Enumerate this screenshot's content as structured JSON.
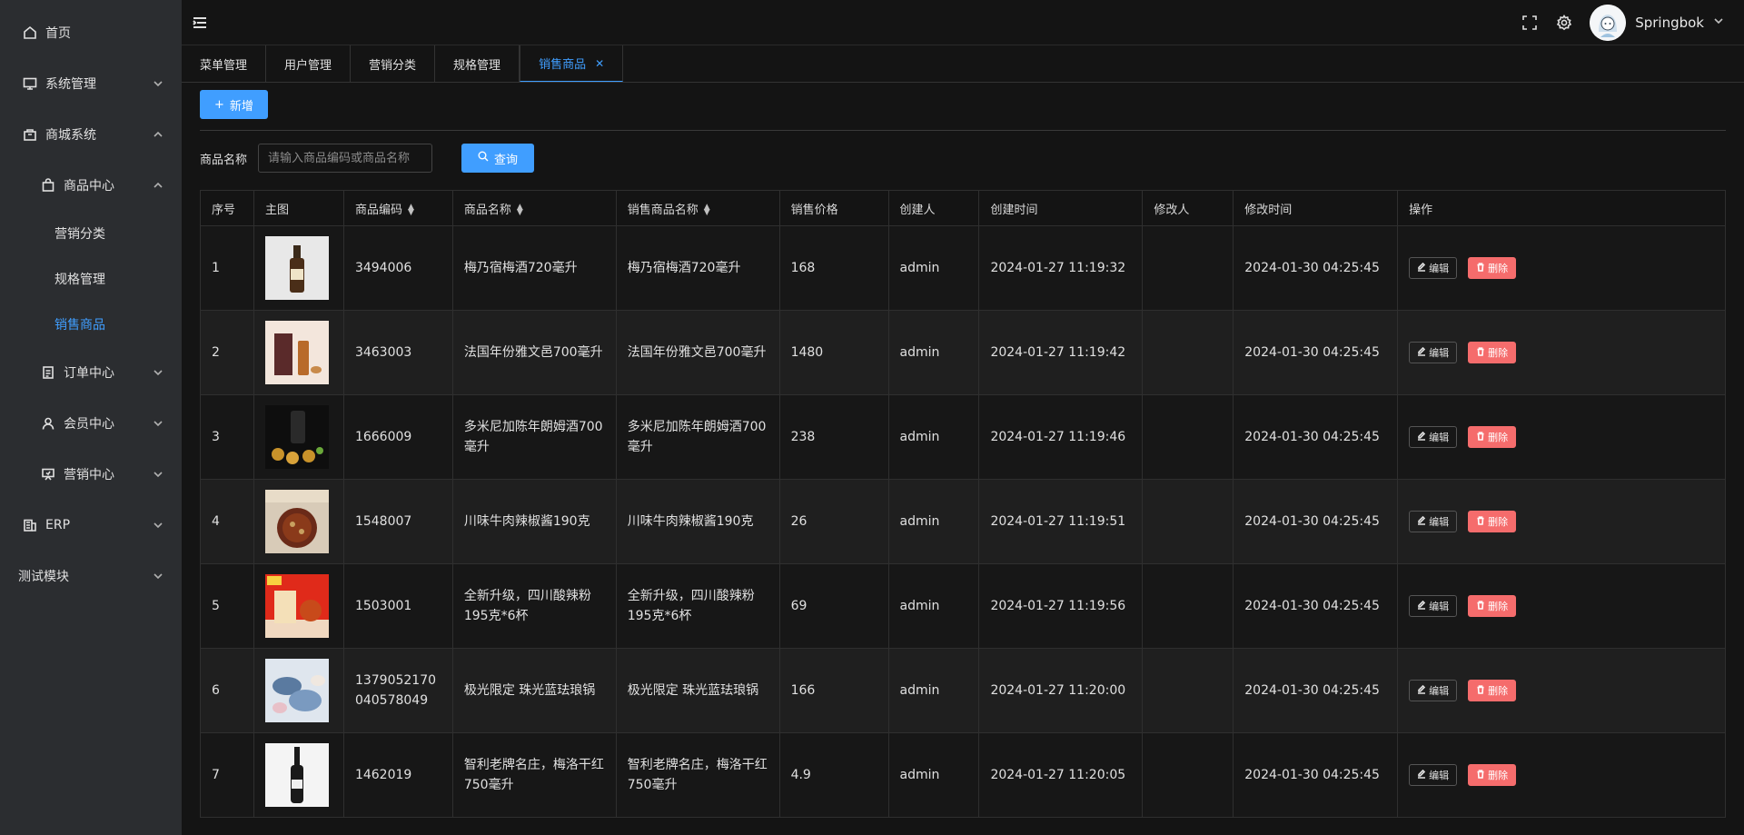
{
  "sidebar": {
    "home": "首页",
    "system": "系统管理",
    "mall": "商城系统",
    "goods_center": "商品中心",
    "marketing_category": "营销分类",
    "spec_manage": "规格管理",
    "sale_goods": "销售商品",
    "order_center": "订单中心",
    "member_center": "会员中心",
    "marketing_center": "营销中心",
    "erp": "ERP",
    "test_module": "测试模块"
  },
  "header": {
    "username": "Springbok"
  },
  "tabs": [
    "菜单管理",
    "用户管理",
    "营销分类",
    "规格管理",
    "销售商品"
  ],
  "toolbar": {
    "add_label": "新增"
  },
  "search": {
    "label": "商品名称",
    "placeholder": "请输入商品编码或商品名称",
    "query_label": "查询"
  },
  "table": {
    "headers": [
      "序号",
      "主图",
      "商品编码",
      "商品名称",
      "销售商品名称",
      "销售价格",
      "创建人",
      "创建时间",
      "修改人",
      "修改时间",
      "操作"
    ],
    "edit_label": "编辑",
    "delete_label": "删除",
    "rows": [
      {
        "no": "1",
        "code": "3494006",
        "name": "梅乃宿梅酒720毫升",
        "sale_name": "梅乃宿梅酒720毫升",
        "price": "168",
        "creator": "admin",
        "created": "2024-01-27 11:19:32",
        "modifier": "",
        "modified": "2024-01-30 04:25:45"
      },
      {
        "no": "2",
        "code": "3463003",
        "name": "法国年份雅文邑700毫升",
        "sale_name": "法国年份雅文邑700毫升",
        "price": "1480",
        "creator": "admin",
        "created": "2024-01-27 11:19:42",
        "modifier": "",
        "modified": "2024-01-30 04:25:45"
      },
      {
        "no": "3",
        "code": "1666009",
        "name": "多米尼加陈年朗姆酒700毫升",
        "sale_name": "多米尼加陈年朗姆酒700毫升",
        "price": "238",
        "creator": "admin",
        "created": "2024-01-27 11:19:46",
        "modifier": "",
        "modified": "2024-01-30 04:25:45"
      },
      {
        "no": "4",
        "code": "1548007",
        "name": "川味牛肉辣椒酱190克",
        "sale_name": "川味牛肉辣椒酱190克",
        "price": "26",
        "creator": "admin",
        "created": "2024-01-27 11:19:51",
        "modifier": "",
        "modified": "2024-01-30 04:25:45"
      },
      {
        "no": "5",
        "code": "1503001",
        "name": "全新升级，四川酸辣粉195克*6杯",
        "sale_name": "全新升级，四川酸辣粉195克*6杯",
        "price": "69",
        "creator": "admin",
        "created": "2024-01-27 11:19:56",
        "modifier": "",
        "modified": "2024-01-30 04:25:45"
      },
      {
        "no": "6",
        "code": "1379052170040578049",
        "name": "极光限定 珠光蓝珐琅锅",
        "sale_name": "极光限定 珠光蓝珐琅锅",
        "price": "166",
        "creator": "admin",
        "created": "2024-01-27 11:20:00",
        "modifier": "",
        "modified": "2024-01-30 04:25:45"
      },
      {
        "no": "7",
        "code": "1462019",
        "name": "智利老牌名庄，梅洛干红750毫升",
        "sale_name": "智利老牌名庄，梅洛干红750毫升",
        "price": "4.9",
        "creator": "admin",
        "created": "2024-01-27 11:20:05",
        "modifier": "",
        "modified": "2024-01-30 04:25:45"
      }
    ]
  },
  "colors": {
    "accent": "#409eff",
    "danger": "#f56c6c",
    "sidebar_bg": "#2b2d30",
    "page_bg": "#141414"
  }
}
